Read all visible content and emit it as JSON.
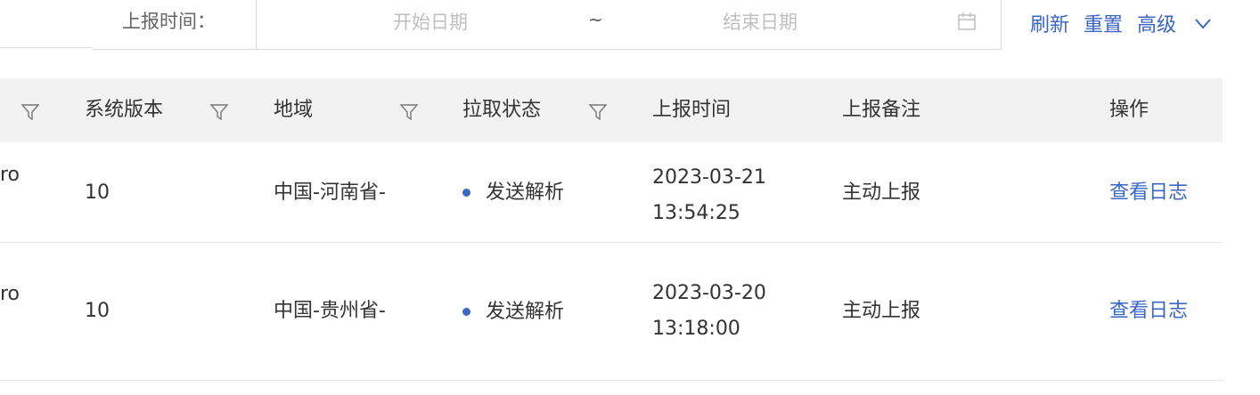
{
  "filter": {
    "date_label": "上报时间：",
    "start_placeholder": "开始日期",
    "separator": "~",
    "end_placeholder": "结束日期",
    "calendar_icon": "calendar-icon",
    "refresh_label": "刷新",
    "reset_label": "重置",
    "advanced_label": "高级",
    "advanced_icon": "chevron-down-icon"
  },
  "table": {
    "columns": [
      {
        "label": "",
        "filterable": true
      },
      {
        "label": "系统版本",
        "filterable": true
      },
      {
        "label": "地域",
        "filterable": true
      },
      {
        "label": "拉取状态",
        "filterable": true
      },
      {
        "label": "上报时间",
        "filterable": false
      },
      {
        "label": "上报备注",
        "filterable": false
      },
      {
        "label": "操作",
        "filterable": false
      }
    ],
    "rows": [
      {
        "clipped": "ro",
        "version": "10",
        "region": "中国-河南省-",
        "status": "发送解析",
        "date": "2023-03-21",
        "time": "13:54:25",
        "remark": "主动上报",
        "action": "查看日志"
      },
      {
        "clipped": "ro",
        "version": "10",
        "region": "中国-贵州省-",
        "status": "发送解析",
        "date": "2023-03-20",
        "time": "13:18:00",
        "remark": "主动上报",
        "action": "查看日志"
      }
    ]
  },
  "colors": {
    "link": "#3a66c6",
    "status_dot": "#3a66c6",
    "header_bg": "#f2f2f2"
  }
}
